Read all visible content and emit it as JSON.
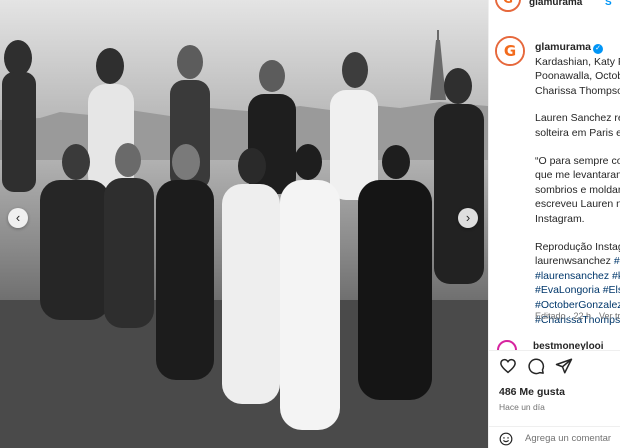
{
  "post": {
    "photo_alt": "Group photo",
    "nav": {
      "prev_icon": "chevron-left-icon",
      "next_icon": "chevron-right-icon"
    }
  },
  "header": {
    "username": "glamurama",
    "follow_label": "S"
  },
  "caption": {
    "username": "glamurama",
    "lines": [
      "Kardashian, Katy Pe",
      "Poonawalla, Octobe",
      "Charissa Thompson"
    ],
    "paragraph2": [
      "Lauren Sanchez reu",
      "solteira em Paris e"
    ],
    "paragraph3": [
      "“O para sempre co",
      "que me levantaram",
      "sombrios e moldar",
      "escreveu Lauren na",
      "Instagram."
    ],
    "paragraph4": [
      "Reprodução Instag",
      "laurenwsanchez"
    ],
    "hashtags": [
      "#laurensanchez #k",
      "#EvaLongoria #Elsa",
      "#OctoberGonzalez",
      "#CharissaThompso"
    ],
    "hashtag_inline": "#L"
  },
  "meta": {
    "edited": "Editado · 22 h",
    "translate": "Ver tra"
  },
  "comment_preview": {
    "username": "bestmoneylooi"
  },
  "actions": {
    "like_icon": "heart-icon",
    "comment_icon": "comment-icon",
    "share_icon": "share-icon"
  },
  "likes": "486 Me gusta",
  "timestamp": "Hace un día",
  "add_comment": {
    "placeholder": "Agrega un comentar"
  },
  "colors": {
    "brand": "#f26b1d",
    "link": "#00376b",
    "verified": "#0095f6",
    "muted": "#737373"
  }
}
